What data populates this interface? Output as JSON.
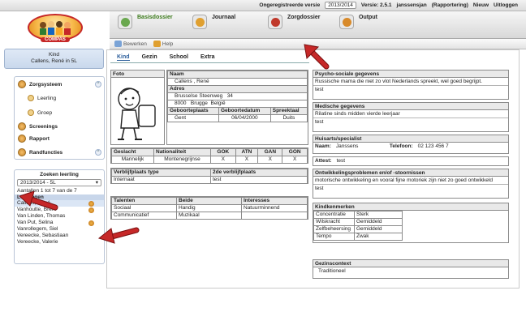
{
  "topbar": {
    "version_label": "Ongeregistreerde versie",
    "year": "2013/2014",
    "version": "Versie: 2.5.1",
    "user": "janssensjan",
    "role": "(Rapportering)",
    "new": "Nieuw",
    "logout": "Uitloggen"
  },
  "logo": {
    "text": "COMPAS"
  },
  "maintabs": [
    {
      "label": "Basisdossier",
      "icon": "basisdossier-icon",
      "color": "#6aa84f"
    },
    {
      "label": "Journaal",
      "icon": "journal-icon",
      "color": "#e0a030"
    },
    {
      "label": "Zorgdossier",
      "icon": "zorgdossier-icon",
      "color": "#c0392b"
    },
    {
      "label": "Output",
      "icon": "output-icon",
      "color": "#d88a2a"
    }
  ],
  "toolbar": {
    "edit": "Bewerken",
    "help": "Help"
  },
  "kind": {
    "title": "Kind",
    "name": "Callens, René in 5L"
  },
  "menu": {
    "zorgsysteem": "Zorgsysteem",
    "leerling": "Leerling",
    "groep": "Groep",
    "screenings": "Screenings",
    "rapport": "Rapport",
    "randfuncties": "Randfuncties"
  },
  "search": {
    "title": "Zoeken leerling",
    "year": "2013/2014 - 5L",
    "count": "Aantallen 1 tot 7 van de 7",
    "header": "Leerlingen",
    "students": [
      "Callens, René",
      "Vanhoutte, Brent",
      "Van Linden, Thomas",
      "Van Put, Selina",
      "Vanrollegem, Siel",
      "Vereecke, Sebastiaan",
      "Vereecke, Valerie"
    ]
  },
  "subtabs": [
    "Kind",
    "Gezin",
    "School",
    "Extra"
  ],
  "child": {
    "foto": "Foto",
    "naam_label": "Naam",
    "naam": "Callens ,   René",
    "adres_label": "Adres",
    "straat": "Brusselse Steenweg",
    "nummer": "34",
    "postcode": "8000",
    "gemeente": "Brugge",
    "land": "België",
    "geboorteplaats_label": "Geboorteplaats",
    "geboortedatum_label": "Geboortedatum",
    "spreektaal_label": "Spreektaal",
    "geboorteplaats": "Gent",
    "geboortedatum": "06/04/2000",
    "spreektaal": "Duits"
  },
  "stats": {
    "headers": [
      "Geslacht",
      "Nationaliteit",
      "GOK",
      "ATN",
      "GAN",
      "GON"
    ],
    "values": [
      "Mannelijk",
      "Montenegrijnse",
      "X",
      "X",
      "X",
      "X"
    ]
  },
  "verblijf": {
    "type_label": "Verblijfplaats type",
    "second_label": "2de verblijfplaats",
    "type": "Internaat",
    "second": "test"
  },
  "talenten": {
    "headers": [
      "Talenten",
      "Beide",
      "Interesses"
    ],
    "rows": [
      [
        "Sociaal",
        "Handig",
        "Natuurminnend"
      ],
      [
        "Communicatief",
        "Muzikaal",
        ""
      ]
    ]
  },
  "right": {
    "psycho_label": "Psycho-sociale gegevens",
    "psycho_text": "Russische mama die niet zo vlot Nederlands spreekt, wel goed begrijpt.",
    "psycho_text2": "test",
    "medisch_label": "Medische gegevens",
    "medisch_text": "Rilatine sinds midden vierde leerjaar",
    "medisch_text2": "test",
    "huisarts_label": "Huisarts/specialist",
    "naam_label": "Naam:",
    "naam": "Janssens",
    "tel_label": "Telefoon:",
    "tel": "02 123 456 7",
    "attest_label": "Attest:",
    "attest": "test",
    "ontw_label": "Ontwikkelingsproblemen en/of -stoornissen",
    "ontw_text": "motorische ontwikkeling en vooral fijne motoriek zijn niet zo goed ontwikkeld",
    "ontw_text2": "test",
    "kenmerken_label": "Kindkenmerken",
    "kenmerken": [
      [
        "Concentratie",
        "Sterk"
      ],
      [
        "Wilskracht",
        "Gemiddeld"
      ],
      [
        "Zelfbeheersing",
        "Gemiddeld"
      ],
      [
        "Tempo",
        "Zwak"
      ]
    ],
    "gezin_label": "Gezinscontext",
    "gezin_text": "Traditioneel"
  },
  "colors": {
    "arrow": "#c62828",
    "accent": "#2d5f9c",
    "panel": "#dfe9f6"
  }
}
